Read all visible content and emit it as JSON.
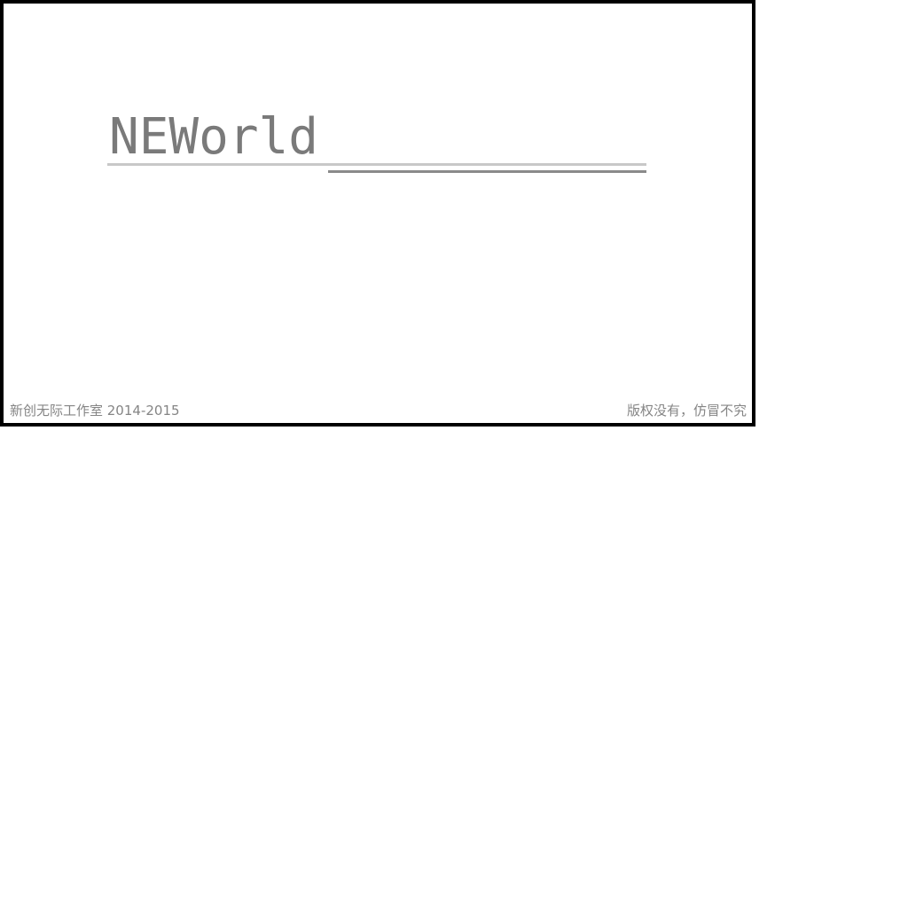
{
  "window": {
    "title": "NEWorld",
    "loading_progress": 0.59,
    "colors": {
      "title": "#7a7a7a",
      "track": "#c8c8c8",
      "fill": "#8a8a8a",
      "footer_text": "#858585",
      "border": "#000000"
    }
  },
  "footer": {
    "left_text": "新创无际工作室 2014-2015",
    "right_text": "版权没有，仿冒不究"
  }
}
